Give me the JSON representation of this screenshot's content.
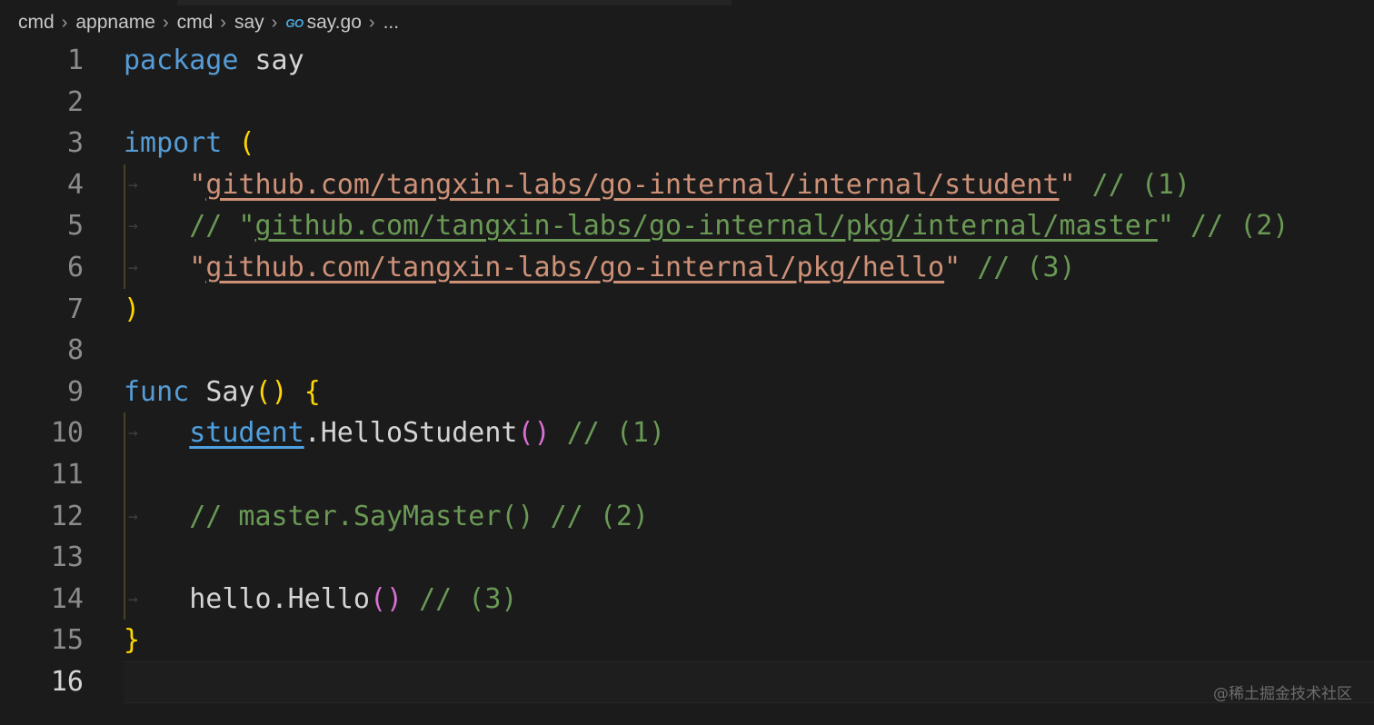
{
  "breadcrumb": {
    "items": [
      "cmd",
      "appname",
      "cmd",
      "say"
    ],
    "file_icon": "go-icon",
    "file_icon_text": "GO",
    "file": "say.go",
    "more": "..."
  },
  "editor": {
    "current_line": 16,
    "lines": [
      {
        "n": "1"
      },
      {
        "n": "2"
      },
      {
        "n": "3"
      },
      {
        "n": "4"
      },
      {
        "n": "5"
      },
      {
        "n": "6"
      },
      {
        "n": "7"
      },
      {
        "n": "8"
      },
      {
        "n": "9"
      },
      {
        "n": "10"
      },
      {
        "n": "11"
      },
      {
        "n": "12"
      },
      {
        "n": "13"
      },
      {
        "n": "14"
      },
      {
        "n": "15"
      },
      {
        "n": "16"
      }
    ],
    "tokens": {
      "l1_kw": "package",
      "l1_name": "say",
      "l3_kw": "import",
      "l3_paren": "(",
      "l4_q1": "\"",
      "l4_path": "github.com/tangxin-labs/go-internal/internal/student",
      "l4_q2": "\"",
      "l4_cmt": "// (1)",
      "l5_cmt_a": "// \"",
      "l5_path": "github.com/tangxin-labs/go-internal/pkg/internal/master",
      "l5_cmt_b": "\" // (2)",
      "l6_q1": "\"",
      "l6_path": "github.com/tangxin-labs/go-internal/pkg/hello",
      "l6_q2": "\"",
      "l6_cmt": "// (3)",
      "l7_paren": ")",
      "l9_kw": "func",
      "l9_name": "Say",
      "l9_parens": "()",
      "l9_brace": "{",
      "l10_pkg": "student",
      "l10_call": ".HelloStudent",
      "l10_parens": "()",
      "l10_cmt": "// (1)",
      "l12_cmt": "// master.SayMaster() // (2)",
      "l14_call": "hello.Hello",
      "l14_parens": "()",
      "l14_cmt": "// (3)",
      "l15_brace": "}"
    },
    "tab_glyph": "→"
  },
  "watermark": "@稀土掘金技术社区",
  "colors": {
    "background": "#1b1b1b",
    "keyword": "#569cd6",
    "string": "#ce9178",
    "comment": "#6a9955",
    "bracket_level1": "#ffd700",
    "bracket_level2": "#da70d6",
    "identifier": "#d4d4d4",
    "line_number": "#8b8b8b"
  }
}
